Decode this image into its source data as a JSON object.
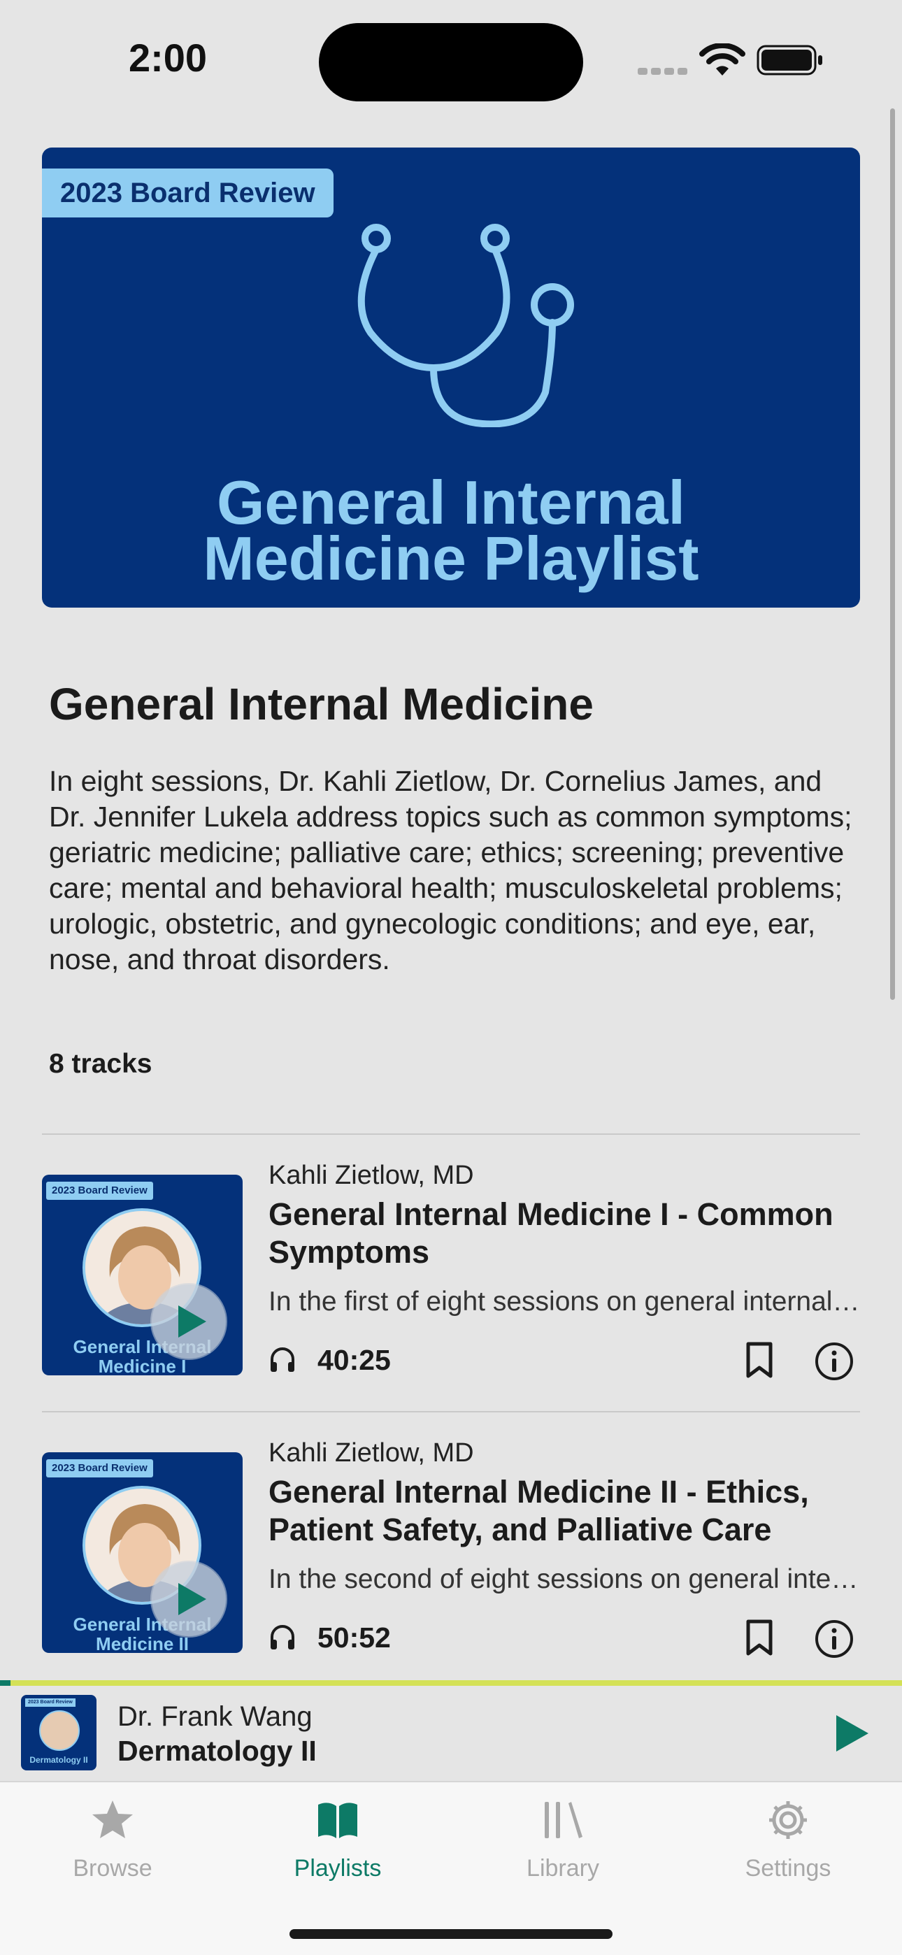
{
  "status_bar": {
    "time": "2:00"
  },
  "hero": {
    "badge": "2023 Board Review",
    "title_line1": "General Internal",
    "title_line2": "Medicine Playlist"
  },
  "playlist": {
    "title": "General Internal Medicine",
    "description": "In eight sessions, Dr. Kahli Zietlow, Dr. Cornelius James, and Dr. Jennifer Lukela address topics such as common symptoms; geriatric medicine; palliative care; ethics; screening; preventive care; mental and behavioral health; musculoskeletal problems; urologic, obstetric, and gynecologic conditions; and eye, ear, nose, and throat disorders.",
    "track_count": "8 tracks"
  },
  "tracks": [
    {
      "author": "Kahli Zietlow, MD",
      "title": "General Internal Medicine I - Common Symptoms",
      "description": "In the first of eight sessions on general internal medicine...",
      "duration": "40:25",
      "thumb_badge": "2023 Board Review",
      "thumb_title_1": "General Internal",
      "thumb_title_2": "Medicine I"
    },
    {
      "author": "Kahli Zietlow, MD",
      "title": "General Internal Medicine II - Ethics, Patient Safety, and Palliative Care",
      "description": "In the second of eight sessions on general internal medicine...",
      "duration": "50:52",
      "thumb_badge": "2023 Board Review",
      "thumb_title_1": "General Internal",
      "thumb_title_2": "Medicine II"
    }
  ],
  "mini_player": {
    "author": "Dr. Frank Wang",
    "title": "Dermatology II",
    "art_badge": "2023 Board Review",
    "art_caption": "Dermatology II",
    "progress": 0.012
  },
  "tab_bar": {
    "tabs": [
      {
        "label": "Browse",
        "icon": "star-icon",
        "active": false
      },
      {
        "label": "Playlists",
        "icon": "book-icon",
        "active": true
      },
      {
        "label": "Library",
        "icon": "library-icon",
        "active": false
      },
      {
        "label": "Settings",
        "icon": "gear-icon",
        "active": false
      }
    ]
  },
  "colors": {
    "accent": "#0d7a66",
    "hero_bg": "#04317a",
    "hero_text": "#8fcdf2",
    "progress_track": "#d4e157"
  }
}
